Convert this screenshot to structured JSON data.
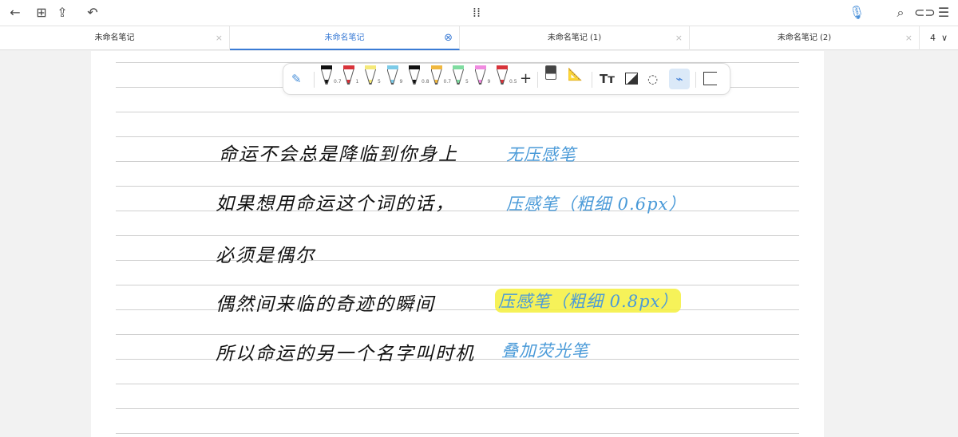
{
  "topbar": {
    "icons": [
      "back-arrow-icon",
      "grid-icon",
      "export-icon",
      "undo-icon",
      "apps-grid-icon",
      "microphone-icon",
      "search-icon",
      "toggle-icon",
      "menu-collapse-icon"
    ]
  },
  "tabs": [
    {
      "label": "未命名笔记",
      "close": "×",
      "active": false
    },
    {
      "label": "未命名笔记",
      "close": "⊗",
      "active": true
    },
    {
      "label": "未命名笔记 (1)",
      "close": "×",
      "active": false
    },
    {
      "label": "未命名笔记 (2)",
      "close": "×",
      "active": false
    }
  ],
  "tab_count": "4",
  "tab_menu": "∨",
  "toolbar": {
    "pens": [
      {
        "color": "#111111",
        "size": "0.7"
      },
      {
        "color": "#d8333a",
        "size": "1"
      },
      {
        "color": "#f5e97a",
        "size": "5"
      },
      {
        "color": "#7ccbe8",
        "size": "9"
      },
      {
        "color": "#111111",
        "size": "0.8"
      },
      {
        "color": "#f0b840",
        "size": "0.7"
      },
      {
        "color": "#7fdca0",
        "size": "5"
      },
      {
        "color": "#f08be0",
        "size": "9"
      },
      {
        "color": "#d8333a",
        "size": "0.5"
      }
    ],
    "add": "+",
    "text_tool": "Tт"
  },
  "notes": {
    "left": [
      "命运不会总是降临到你身上",
      "如果想用命运这个词的话，",
      "必须是偶尔",
      "偶然间来临的奇迹的瞬间",
      "所以命运的另一个名字叫时机"
    ],
    "right": [
      "无压感笔",
      "压感笔（粗细 0.6px）",
      "压感笔（粗细 0.8px）",
      "叠加荧光笔"
    ]
  }
}
